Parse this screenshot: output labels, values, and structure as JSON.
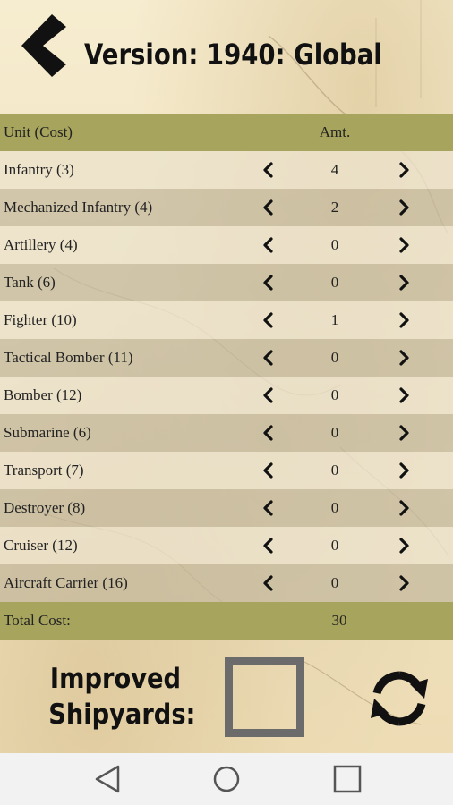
{
  "header": {
    "title": "Version: 1940: Global",
    "back_icon": "chevron-left-icon"
  },
  "table": {
    "col_unit": "Unit (Cost)",
    "col_amt": "Amt.",
    "rows": [
      {
        "name": "Infantry (3)",
        "amt": "4"
      },
      {
        "name": "Mechanized Infantry (4)",
        "amt": "2"
      },
      {
        "name": "Artillery (4)",
        "amt": "0"
      },
      {
        "name": "Tank (6)",
        "amt": "0"
      },
      {
        "name": "Fighter (10)",
        "amt": "1"
      },
      {
        "name": "Tactical Bomber (11)",
        "amt": "0"
      },
      {
        "name": "Bomber (12)",
        "amt": "0"
      },
      {
        "name": "Submarine (6)",
        "amt": "0"
      },
      {
        "name": "Transport (7)",
        "amt": "0"
      },
      {
        "name": "Destroyer (8)",
        "amt": "0"
      },
      {
        "name": "Cruiser (12)",
        "amt": "0"
      },
      {
        "name": "Aircraft Carrier (16)",
        "amt": "0"
      }
    ],
    "total_label": "Total Cost:",
    "total_value": "30"
  },
  "options": {
    "improved_shipyards_line1": "Improved",
    "improved_shipyards_line2": "Shipyards:",
    "improved_shipyards_checked": false,
    "reset_icon": "refresh-icon"
  },
  "navbar": {
    "back_icon": "triangle-back-icon",
    "home_icon": "circle-home-icon",
    "recent_icon": "square-recents-icon"
  },
  "colors": {
    "header_band": "#a7a45d",
    "row_light": "#ece3cd",
    "row_dark": "#c4b99e",
    "checkbox_border": "#6b6b6b",
    "navbar_bg": "#f2f2f2"
  }
}
